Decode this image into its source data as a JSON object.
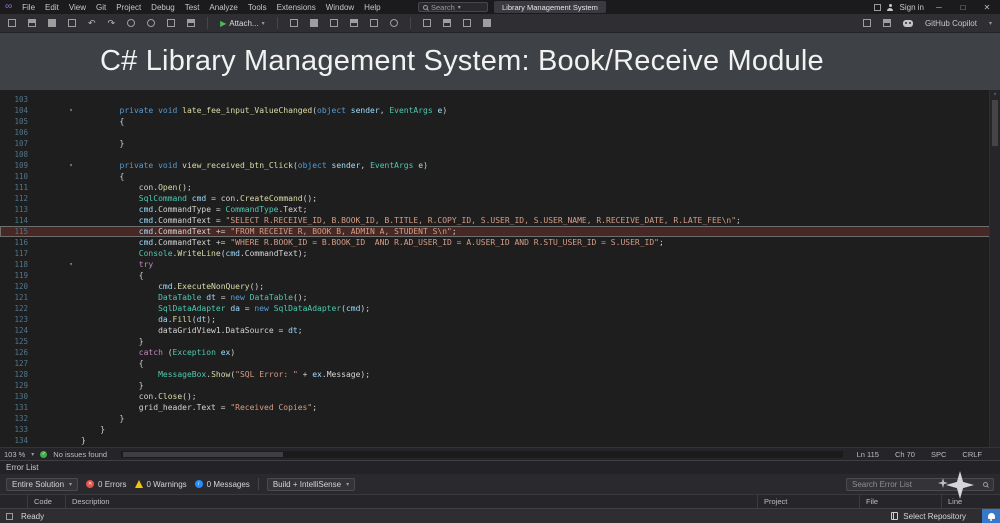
{
  "icons": {
    "logo": "∞",
    "chevron_down": "▾",
    "play": "▶",
    "undo": "↶",
    "redo": "↷",
    "minimize": "─",
    "maximize": "□",
    "close": "✕",
    "fold": "▾",
    "scroll_up": "▴",
    "error_x": "✕",
    "check": "✓",
    "info_i": "i"
  },
  "titlebar": {
    "menus": [
      "File",
      "Edit",
      "View",
      "Git",
      "Project",
      "Debug",
      "Test",
      "Analyze",
      "Tools",
      "Extensions",
      "Window",
      "Help"
    ],
    "search_label": "Search",
    "document_title": "Library Management System",
    "sign_in": "Sign in"
  },
  "toolbar": {
    "attach_label": "Attach...",
    "copilot_label": "GitHub Copilot"
  },
  "banner": {
    "title": "C# Library Management System: Book/Receive Module"
  },
  "editor": {
    "current_line": 115,
    "zoom": "103 %",
    "health": "No issues found",
    "position": {
      "ln": "Ln 115",
      "col": "Ch 70",
      "spc": "SPC",
      "eol": "CRLF"
    },
    "lines": [
      {
        "n": 103,
        "ind": 0,
        "segs": []
      },
      {
        "n": 104,
        "ind": 8,
        "fold": true,
        "segs": [
          [
            "k",
            "private"
          ],
          [
            "p",
            " "
          ],
          [
            "k",
            "void"
          ],
          [
            "p",
            " "
          ],
          [
            "m",
            "late_fee_input_ValueChanged"
          ],
          [
            "p",
            "("
          ],
          [
            "k",
            "object"
          ],
          [
            "p",
            " "
          ],
          [
            "v",
            "sender"
          ],
          [
            "p",
            ", "
          ],
          [
            "t",
            "EventArgs"
          ],
          [
            "p",
            " "
          ],
          [
            "v",
            "e"
          ],
          [
            "p",
            ")"
          ]
        ]
      },
      {
        "n": 105,
        "ind": 8,
        "segs": [
          [
            "p",
            "{"
          ]
        ]
      },
      {
        "n": 106,
        "ind": 0,
        "segs": []
      },
      {
        "n": 107,
        "ind": 8,
        "segs": [
          [
            "p",
            "}"
          ]
        ]
      },
      {
        "n": 108,
        "ind": 0,
        "segs": []
      },
      {
        "n": 109,
        "ind": 8,
        "fold": true,
        "segs": [
          [
            "k",
            "private"
          ],
          [
            "p",
            " "
          ],
          [
            "k",
            "void"
          ],
          [
            "p",
            " "
          ],
          [
            "m",
            "view_received_btn_Click"
          ],
          [
            "p",
            "("
          ],
          [
            "k",
            "object"
          ],
          [
            "p",
            " "
          ],
          [
            "v",
            "sender"
          ],
          [
            "p",
            ", "
          ],
          [
            "t",
            "EventArgs"
          ],
          [
            "p",
            " "
          ],
          [
            "v",
            "e"
          ],
          [
            "p",
            ")"
          ]
        ]
      },
      {
        "n": 110,
        "ind": 8,
        "segs": [
          [
            "p",
            "{"
          ]
        ]
      },
      {
        "n": 111,
        "ind": 12,
        "segs": [
          [
            "p",
            "con."
          ],
          [
            "m",
            "Open"
          ],
          [
            "p",
            "();"
          ]
        ]
      },
      {
        "n": 112,
        "ind": 12,
        "segs": [
          [
            "t",
            "SqlCommand"
          ],
          [
            "p",
            " "
          ],
          [
            "v",
            "cmd"
          ],
          [
            "p",
            " = con."
          ],
          [
            "m",
            "CreateCommand"
          ],
          [
            "p",
            "();"
          ]
        ]
      },
      {
        "n": 113,
        "ind": 12,
        "segs": [
          [
            "v",
            "cmd"
          ],
          [
            "p",
            ".CommandType = "
          ],
          [
            "t",
            "CommandType"
          ],
          [
            "p",
            ".Text;"
          ]
        ]
      },
      {
        "n": 114,
        "ind": 12,
        "segs": [
          [
            "v",
            "cmd"
          ],
          [
            "p",
            ".CommandText = "
          ],
          [
            "s",
            "\"SELECT R.RECEIVE_ID, B.BOOK_ID, B.TITLE, R.COPY_ID, S.USER_ID, S.USER_NAME, R.RECEIVE_DATE, R.LATE_FEE\\n\""
          ],
          [
            "p",
            ";"
          ]
        ]
      },
      {
        "n": 115,
        "ind": 12,
        "segs": [
          [
            "v",
            "cmd"
          ],
          [
            "p",
            ".CommandText += "
          ],
          [
            "s",
            "\"FROM RECEIVE R, BOOK B, ADMIN A, STUDENT S\\n\""
          ],
          [
            "p",
            ";"
          ]
        ]
      },
      {
        "n": 116,
        "ind": 12,
        "segs": [
          [
            "v",
            "cmd"
          ],
          [
            "p",
            ".CommandText += "
          ],
          [
            "s",
            "\"WHERE R.BOOK_ID = B.BOOK_ID  AND R.AD_USER_ID = A.USER_ID AND R.STU_USER_ID = S.USER_ID\""
          ],
          [
            "p",
            ";"
          ]
        ]
      },
      {
        "n": 117,
        "ind": 12,
        "segs": [
          [
            "t",
            "Console"
          ],
          [
            "p",
            "."
          ],
          [
            "m",
            "WriteLine"
          ],
          [
            "p",
            "("
          ],
          [
            "v",
            "cmd"
          ],
          [
            "p",
            ".CommandText);"
          ]
        ]
      },
      {
        "n": 118,
        "ind": 12,
        "fold": true,
        "segs": [
          [
            "c",
            "try"
          ]
        ]
      },
      {
        "n": 119,
        "ind": 12,
        "segs": [
          [
            "p",
            "{"
          ]
        ]
      },
      {
        "n": 120,
        "ind": 16,
        "segs": [
          [
            "v",
            "cmd"
          ],
          [
            "p",
            "."
          ],
          [
            "m",
            "ExecuteNonQuery"
          ],
          [
            "p",
            "();"
          ]
        ]
      },
      {
        "n": 121,
        "ind": 16,
        "segs": [
          [
            "t",
            "DataTable"
          ],
          [
            "p",
            " "
          ],
          [
            "v",
            "dt"
          ],
          [
            "p",
            " = "
          ],
          [
            "k",
            "new"
          ],
          [
            "p",
            " "
          ],
          [
            "t",
            "DataTable"
          ],
          [
            "p",
            "();"
          ]
        ]
      },
      {
        "n": 122,
        "ind": 16,
        "segs": [
          [
            "t",
            "SqlDataAdapter"
          ],
          [
            "p",
            " "
          ],
          [
            "v",
            "da"
          ],
          [
            "p",
            " = "
          ],
          [
            "k",
            "new"
          ],
          [
            "p",
            " "
          ],
          [
            "t",
            "SqlDataAdapter"
          ],
          [
            "p",
            "("
          ],
          [
            "v",
            "cmd"
          ],
          [
            "p",
            ");"
          ]
        ]
      },
      {
        "n": 123,
        "ind": 16,
        "segs": [
          [
            "v",
            "da"
          ],
          [
            "p",
            "."
          ],
          [
            "m",
            "Fill"
          ],
          [
            "p",
            "("
          ],
          [
            "v",
            "dt"
          ],
          [
            "p",
            ");"
          ]
        ]
      },
      {
        "n": 124,
        "ind": 16,
        "segs": [
          [
            "p",
            "dataGridView1.DataSource = "
          ],
          [
            "v",
            "dt"
          ],
          [
            "p",
            ";"
          ]
        ]
      },
      {
        "n": 125,
        "ind": 12,
        "segs": [
          [
            "p",
            "}"
          ]
        ]
      },
      {
        "n": 126,
        "ind": 12,
        "segs": [
          [
            "c",
            "catch"
          ],
          [
            "p",
            " ("
          ],
          [
            "t",
            "Exception"
          ],
          [
            "p",
            " "
          ],
          [
            "v",
            "ex"
          ],
          [
            "p",
            ")"
          ]
        ]
      },
      {
        "n": 127,
        "ind": 12,
        "segs": [
          [
            "p",
            "{"
          ]
        ]
      },
      {
        "n": 128,
        "ind": 16,
        "segs": [
          [
            "t",
            "MessageBox"
          ],
          [
            "p",
            "."
          ],
          [
            "m",
            "Show"
          ],
          [
            "p",
            "("
          ],
          [
            "s",
            "\"SQL Error: \""
          ],
          [
            "p",
            " + "
          ],
          [
            "v",
            "ex"
          ],
          [
            "p",
            ".Message);"
          ]
        ]
      },
      {
        "n": 129,
        "ind": 12,
        "segs": [
          [
            "p",
            "}"
          ]
        ]
      },
      {
        "n": 130,
        "ind": 12,
        "segs": [
          [
            "p",
            "con."
          ],
          [
            "m",
            "Close"
          ],
          [
            "p",
            "();"
          ]
        ]
      },
      {
        "n": 131,
        "ind": 12,
        "segs": [
          [
            "p",
            "grid_header.Text = "
          ],
          [
            "s",
            "\"Received Copies\""
          ],
          [
            "p",
            ";"
          ]
        ]
      },
      {
        "n": 132,
        "ind": 8,
        "segs": [
          [
            "p",
            "}"
          ]
        ]
      },
      {
        "n": 133,
        "ind": 4,
        "segs": [
          [
            "p",
            "}"
          ]
        ]
      },
      {
        "n": 134,
        "ind": 0,
        "segs": [
          [
            "p",
            "}"
          ]
        ]
      }
    ]
  },
  "error_list": {
    "title": "Error List",
    "scope": "Entire Solution",
    "errors": "0 Errors",
    "warnings": "0 Warnings",
    "messages": "0 Messages",
    "filter": "Build + IntelliSense",
    "search_placeholder": "Search Error List",
    "columns": [
      "Code",
      "Description",
      "Project",
      "File",
      "Line"
    ]
  },
  "statusbar": {
    "ready": "Ready",
    "repo": "Select Repository"
  }
}
